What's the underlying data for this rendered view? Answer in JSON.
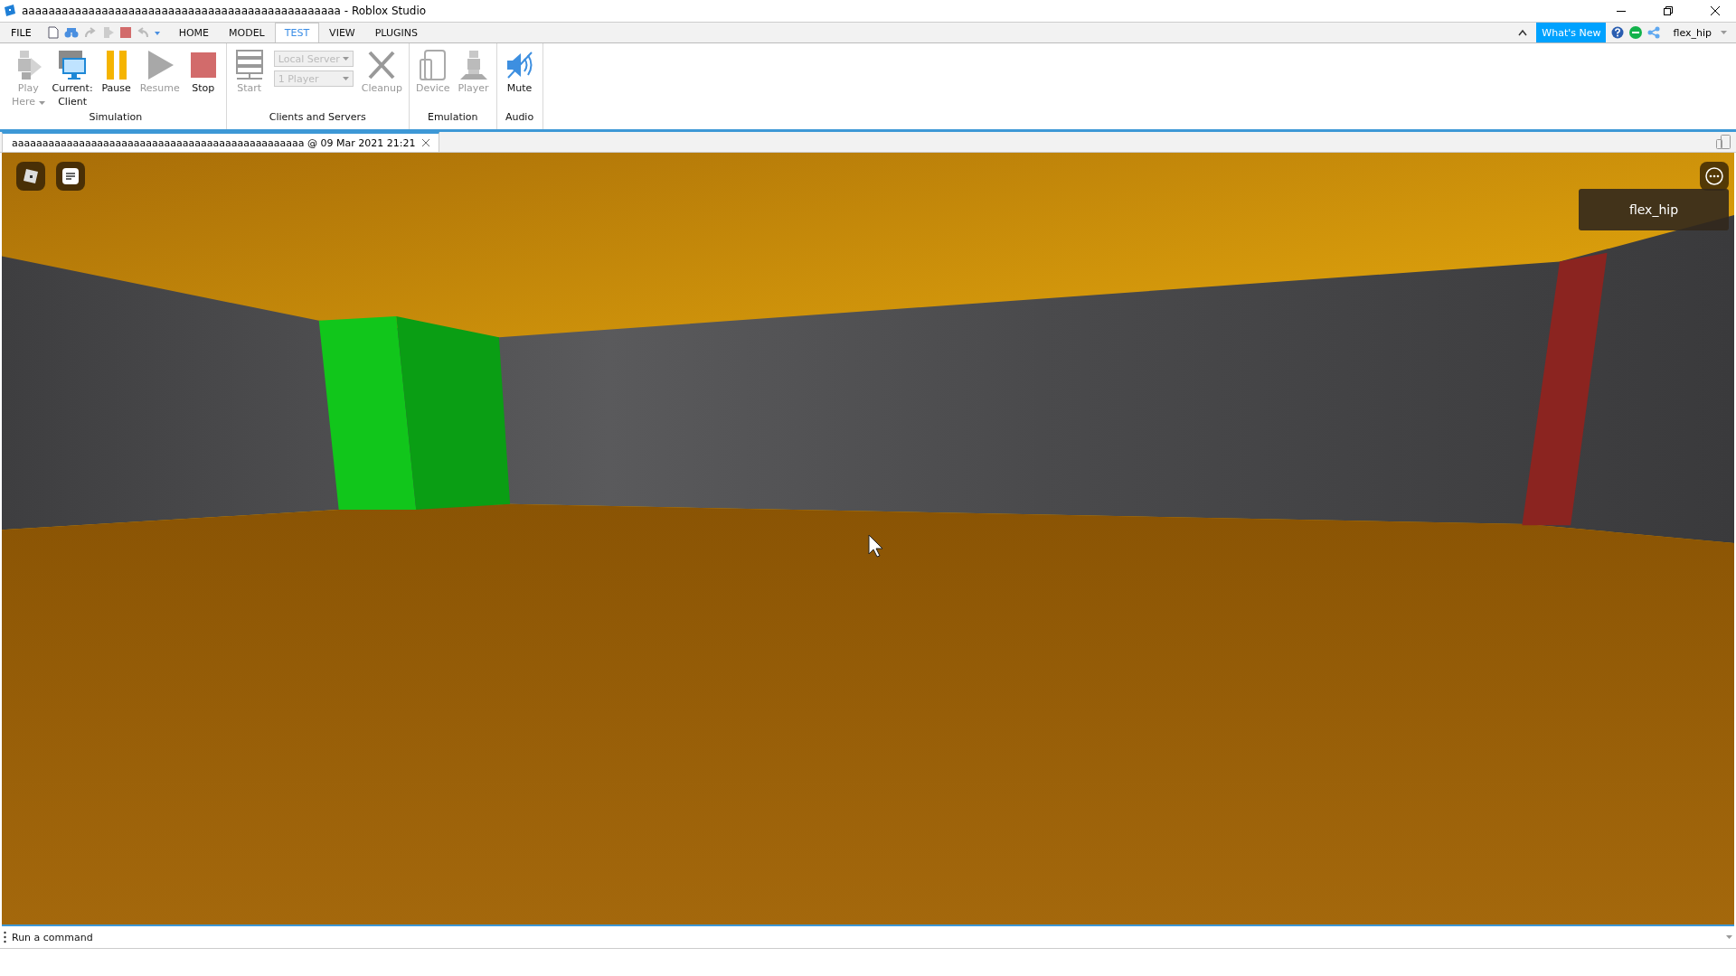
{
  "window": {
    "title": "aaaaaaaaaaaaaaaaaaaaaaaaaaaaaaaaaaaaaaaaaaaaaaaa - Roblox Studio"
  },
  "menu": {
    "file": "FILE",
    "tabs": [
      {
        "label": "HOME",
        "selected": false
      },
      {
        "label": "MODEL",
        "selected": false
      },
      {
        "label": "TEST",
        "selected": true
      },
      {
        "label": "VIEW",
        "selected": false
      },
      {
        "label": "PLUGINS",
        "selected": false
      }
    ],
    "whats_new": "What's New",
    "user": "flex_hip"
  },
  "ribbon": [
    {
      "label": "Simulation",
      "items": [
        {
          "kind": "button",
          "lines": [
            "Play",
            "Here"
          ],
          "disabled": true
        },
        {
          "kind": "button",
          "lines": [
            "Current:",
            "Client"
          ],
          "disabled": false
        },
        {
          "kind": "button",
          "lines": [
            "Pause"
          ],
          "disabled": false
        },
        {
          "kind": "button",
          "lines": [
            "Resume"
          ],
          "disabled": true
        },
        {
          "kind": "button",
          "lines": [
            "Stop"
          ],
          "disabled": false
        }
      ]
    },
    {
      "label": "Clients and Servers",
      "items": [
        {
          "kind": "button",
          "lines": [
            "Start"
          ],
          "disabled": true
        },
        {
          "kind": "dropdowns",
          "options": [
            {
              "value": "Local Server",
              "disabled": true
            },
            {
              "value": "1 Player",
              "disabled": true
            }
          ]
        },
        {
          "kind": "button",
          "lines": [
            "Cleanup"
          ],
          "disabled": true
        }
      ]
    },
    {
      "label": "Emulation",
      "items": [
        {
          "kind": "button",
          "lines": [
            "Device"
          ],
          "disabled": true
        },
        {
          "kind": "button",
          "lines": [
            "Player"
          ],
          "disabled": true
        }
      ]
    },
    {
      "label": "Audio",
      "items": [
        {
          "kind": "button",
          "lines": [
            "Mute"
          ],
          "disabled": false
        }
      ]
    }
  ],
  "document_tab": {
    "label": "aaaaaaaaaaaaaaaaaaaaaaaaaaaaaaaaaaaaaaaaaaaaaaaa @ 09 Mar 2021 21:21",
    "selected": true
  },
  "viewport": {
    "player_name": "flex_hip"
  },
  "command_bar": {
    "placeholder": "Run a command"
  }
}
